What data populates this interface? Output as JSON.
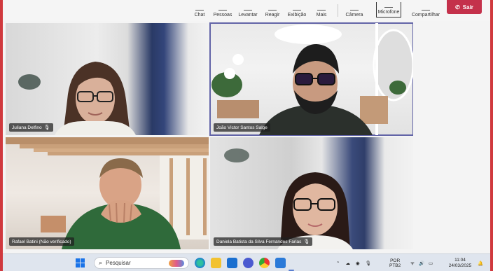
{
  "toolbar": {
    "chat": "Chat",
    "people": "Pessoas",
    "raise": "Levantar",
    "react": "Reagir",
    "view": "Exibição",
    "more": "Mais",
    "camera": "Câmera",
    "mic": "Microfone",
    "share": "Compartilhar",
    "leave": "Sair"
  },
  "participants": [
    {
      "name": "Juliana Delfino",
      "muted": true
    },
    {
      "name": "João Victor Santos Salge",
      "muted": false,
      "active": true
    },
    {
      "name": "Rafael Batini (Não verificado)",
      "muted": false
    },
    {
      "name": "Daniela Batista da Silva Fernandes Farias",
      "muted": true
    }
  ],
  "taskbar": {
    "search_placeholder": "Pesquisar",
    "lang_top": "POR",
    "lang_bottom": "PTB2",
    "time": "11:04",
    "date": "24/03/2025"
  },
  "colors": {
    "accent": "#6264a7",
    "leave": "#c4314b",
    "border": "#d0393e"
  }
}
